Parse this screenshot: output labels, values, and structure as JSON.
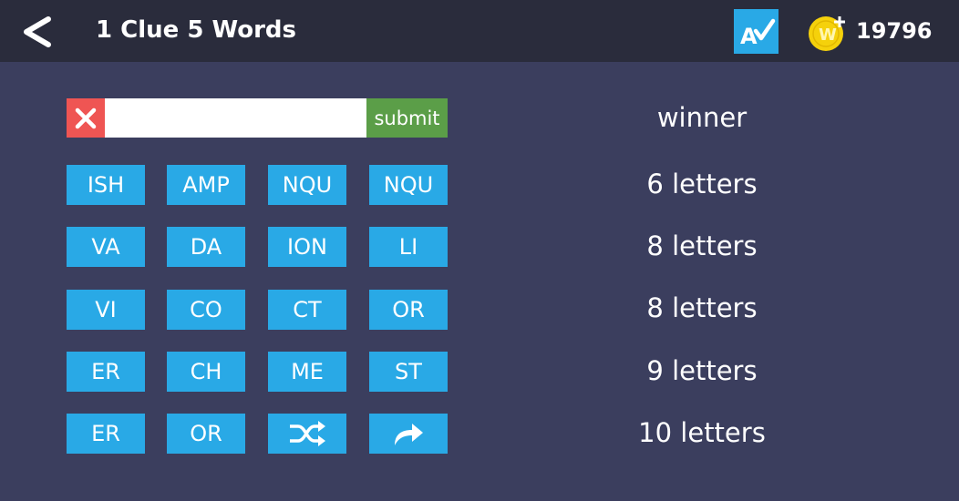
{
  "header": {
    "title": "1 Clue 5 Words",
    "coins": "19796",
    "back_icon": "chevron-left-icon",
    "spell_icon": "spell-check-icon",
    "coin_icon": "coin-icon",
    "coin_letter": "W"
  },
  "answer": {
    "value": "",
    "placeholder": "",
    "submit_label": "submit",
    "clear_icon": "close-icon"
  },
  "tiles": [
    [
      "ISH",
      "AMP",
      "NQU",
      "NQU"
    ],
    [
      "VA",
      "DA",
      "ION",
      "LI"
    ],
    [
      "VI",
      "CO",
      "CT",
      "OR"
    ],
    [
      "ER",
      "CH",
      "ME",
      "ST"
    ],
    [
      "ER",
      "OR"
    ]
  ],
  "actions": {
    "shuffle_icon": "shuffle-icon",
    "hint_icon": "share-arrow-icon"
  },
  "clue": "winner",
  "word_lengths": [
    "6 letters",
    "8 letters",
    "8 letters",
    "9 letters",
    "10 letters"
  ],
  "colors": {
    "background": "#3b3e5e",
    "topbar": "#2a2c3c",
    "tile": "#29a9e6",
    "clear": "#ef5553",
    "submit": "#5b9e48",
    "coin": "#f5d10b"
  }
}
